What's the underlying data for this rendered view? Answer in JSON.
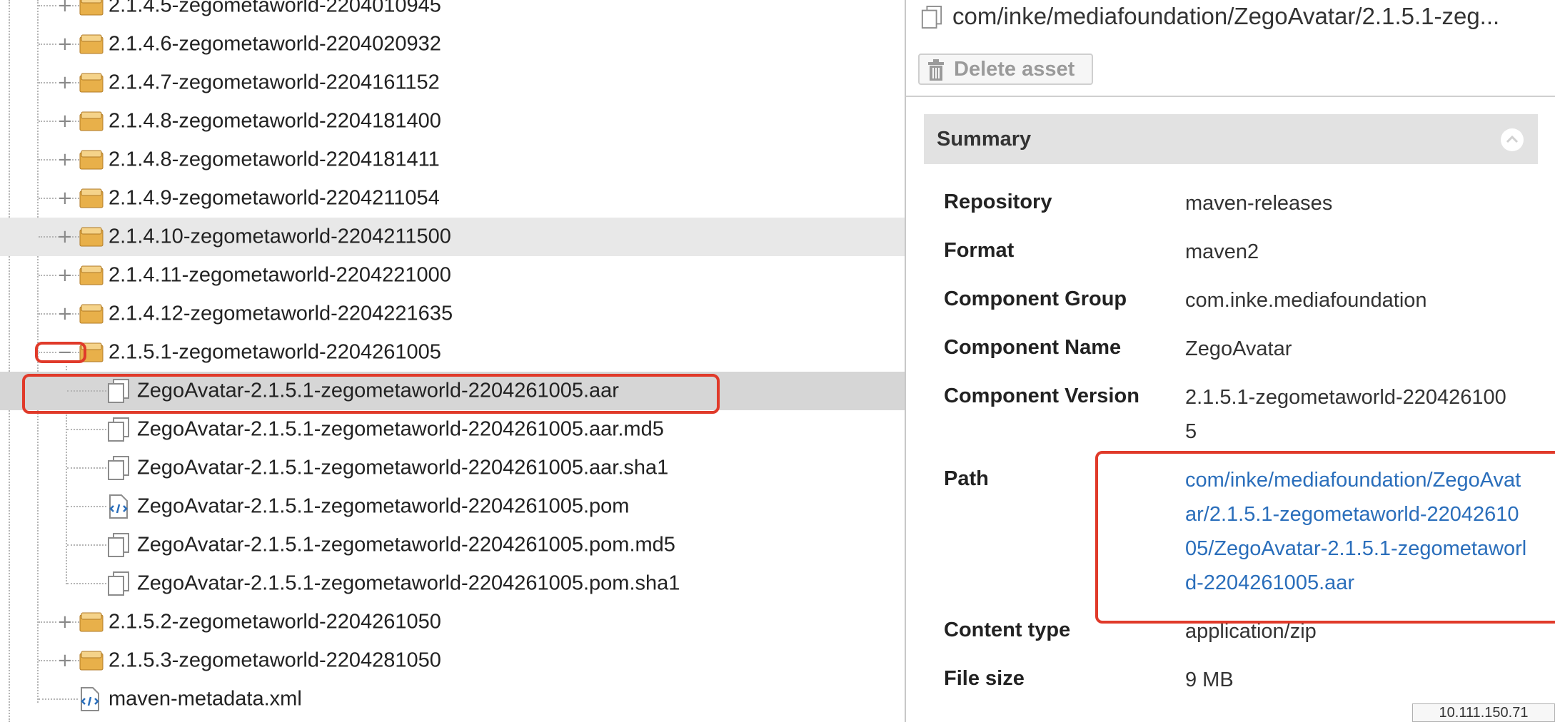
{
  "tree": {
    "rows": [
      {
        "label": "2.1.4.5-zegometaworld-2204010945",
        "type": "folder"
      },
      {
        "label": "2.1.4.6-zegometaworld-2204020932",
        "type": "folder"
      },
      {
        "label": "2.1.4.7-zegometaworld-2204161152",
        "type": "folder"
      },
      {
        "label": "2.1.4.8-zegometaworld-2204181400",
        "type": "folder"
      },
      {
        "label": "2.1.4.8-zegometaworld-2204181411",
        "type": "folder"
      },
      {
        "label": "2.1.4.9-zegometaworld-2204211054",
        "type": "folder"
      },
      {
        "label": "2.1.4.10-zegometaworld-2204211500",
        "type": "folder"
      },
      {
        "label": "2.1.4.11-zegometaworld-2204221000",
        "type": "folder"
      },
      {
        "label": "2.1.4.12-zegometaworld-2204221635",
        "type": "folder"
      },
      {
        "label": "2.1.5.1-zegometaworld-2204261005",
        "type": "folder",
        "expanded": true
      },
      {
        "label": "ZegoAvatar-2.1.5.1-zegometaworld-2204261005.aar",
        "type": "file"
      },
      {
        "label": "ZegoAvatar-2.1.5.1-zegometaworld-2204261005.aar.md5",
        "type": "file"
      },
      {
        "label": "ZegoAvatar-2.1.5.1-zegometaworld-2204261005.aar.sha1",
        "type": "file"
      },
      {
        "label": "ZegoAvatar-2.1.5.1-zegometaworld-2204261005.pom",
        "type": "xml"
      },
      {
        "label": "ZegoAvatar-2.1.5.1-zegometaworld-2204261005.pom.md5",
        "type": "file"
      },
      {
        "label": "ZegoAvatar-2.1.5.1-zegometaworld-2204261005.pom.sha1",
        "type": "file"
      },
      {
        "label": "2.1.5.2-zegometaworld-2204261050",
        "type": "folder"
      },
      {
        "label": "2.1.5.3-zegometaworld-2204281050",
        "type": "folder"
      },
      {
        "label": "maven-metadata.xml",
        "type": "xml"
      }
    ],
    "toggle_collapsed": "+",
    "toggle_expanded": "−"
  },
  "panel": {
    "title": "com/inke/mediafoundation/ZegoAvatar/2.1.5.1-zeg...",
    "delete_label": "Delete asset",
    "summary_title": "Summary",
    "fields": {
      "repository": {
        "label": "Repository",
        "value": "maven-releases"
      },
      "format": {
        "label": "Format",
        "value": "maven2"
      },
      "group": {
        "label": "Component Group",
        "value": "com.inke.mediafoundation"
      },
      "name": {
        "label": "Component Name",
        "value": "ZegoAvatar"
      },
      "version": {
        "label": "Component Version",
        "value": "2.1.5.1-zegometaworld-2204261005"
      },
      "path": {
        "label": "Path",
        "value": "com/inke/mediafoundation/ZegoAvatar/2.1.5.1-zegometaworld-2204261005/ZegoAvatar-2.1.5.1-zegometaworld-2204261005.aar"
      },
      "content_type": {
        "label": "Content type",
        "value": "application/zip"
      },
      "file_size": {
        "label": "File size",
        "value": "9 MB"
      }
    }
  },
  "ip_badge": "10.111.150.71",
  "colors": {
    "highlight": "#e03a2a",
    "link": "#2a6ebb",
    "selected_row": "#d6d6d6",
    "hover_row": "#e8e8e8"
  }
}
